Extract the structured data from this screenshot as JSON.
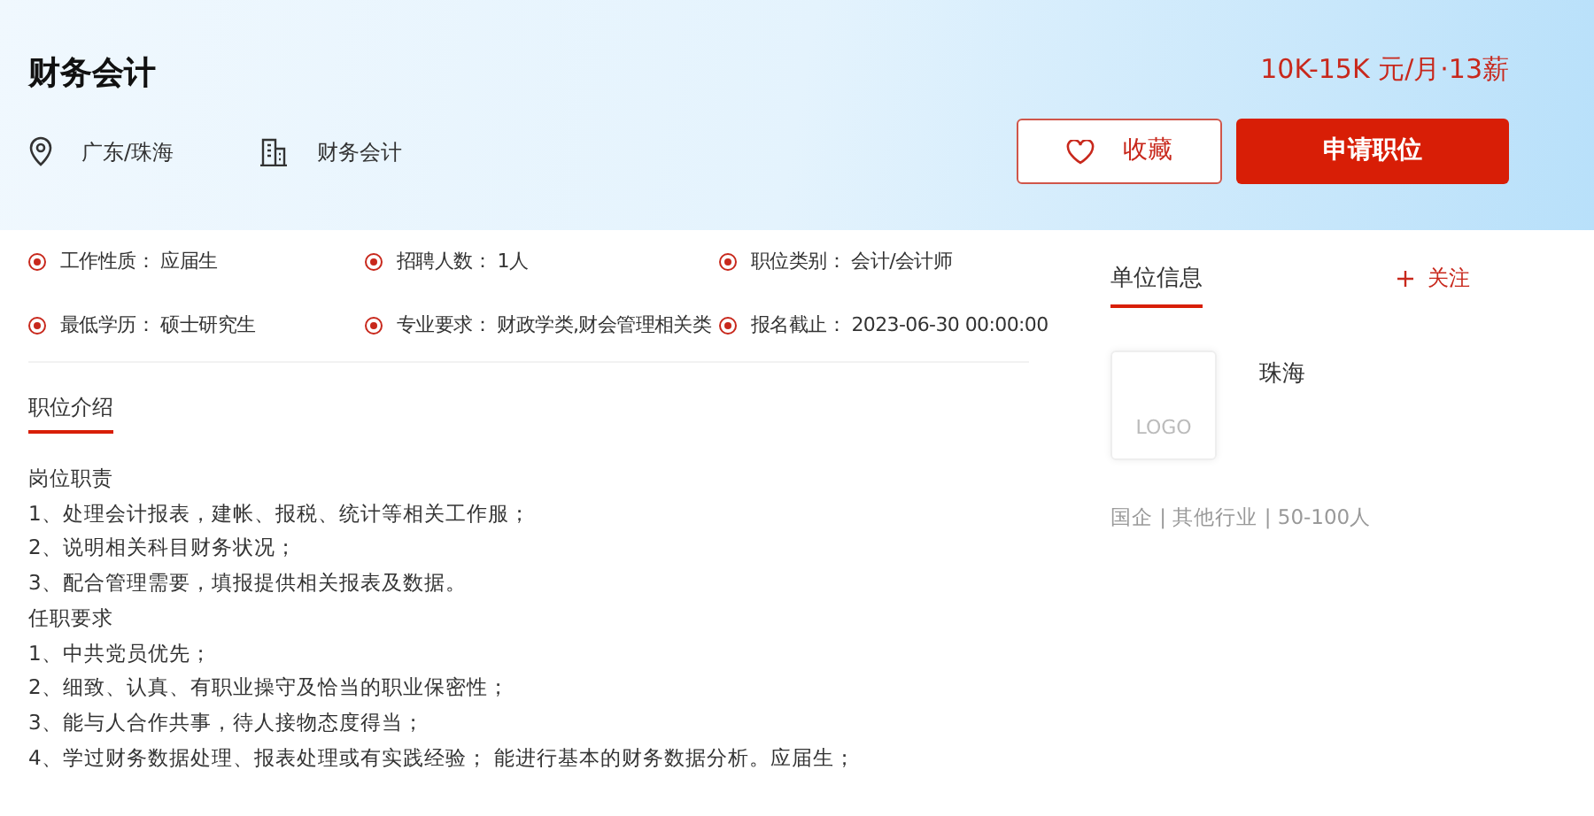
{
  "job": {
    "title": "财务会计",
    "salary": "10K-15K 元/月·13薪",
    "location": "广东/珠海",
    "category": "财务会计"
  },
  "actions": {
    "favorite": "收藏",
    "apply": "申请职位"
  },
  "details": [
    {
      "label": "工作性质：",
      "value": "应届生"
    },
    {
      "label": "招聘人数：",
      "value": "1人"
    },
    {
      "label": "职位类别：",
      "value": "会计/会计师"
    },
    {
      "label": "最低学历：",
      "value": "硕士研究生"
    },
    {
      "label": "专业要求：",
      "value": "财政学类,财会管理相关类"
    },
    {
      "label": "报名截止：",
      "value": "2023-06-30 00:00:00"
    }
  ],
  "description": {
    "heading": "职位介绍",
    "lines": [
      "岗位职责",
      "1、处理会计报表，建帐、报税、统计等相关工作服；",
      "2、说明相关科目财务状况；",
      "3、配合管理需要，填报提供相关报表及数据。",
      "任职要求",
      "1、中共党员优先；",
      "2、细致、认真、有职业操守及恰当的职业保密性；",
      "3、能与人合作共事，待人接物态度得当；",
      "4、学过财务数据处理、报表处理或有实践经验； 能进行基本的财务数据分析。应届生；"
    ]
  },
  "company": {
    "heading": "单位信息",
    "follow": "关注",
    "logo_text": "LOGO",
    "name": "珠海",
    "tags": "国企 | 其他行业 | 50-100人"
  }
}
